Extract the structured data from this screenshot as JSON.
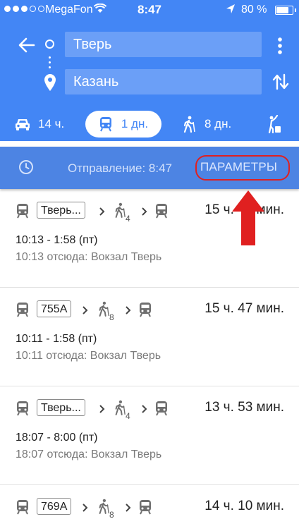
{
  "status_bar": {
    "carrier": "MegaFon",
    "time": "8:47",
    "battery_pct": "80 %",
    "battery_level": 0.8,
    "signal_bars_filled": 3,
    "signal_bars_total": 5
  },
  "search": {
    "origin": "Тверь",
    "destination": "Казань"
  },
  "modes": {
    "car": "14 ч.",
    "transit": "1 дн.",
    "walk": "8 дн."
  },
  "departure": {
    "label": "Отправление: 8:47",
    "params_label": "ПАРАМЕТРЫ"
  },
  "routes": [
    {
      "badge": "Тверь...",
      "walk_minutes": "4",
      "duration": "15 ч. 47 мин.",
      "times": "10:13 - 1:58 (пт)",
      "from": "10:13 отсюда: Вокзал Тверь"
    },
    {
      "badge": "755A",
      "walk_minutes": "8",
      "duration": "15 ч. 47 мин.",
      "times": "10:11 - 1:58 (пт)",
      "from": "10:11 отсюда: Вокзал Тверь"
    },
    {
      "badge": "Тверь...",
      "walk_minutes": "4",
      "duration": "13 ч. 53 мин.",
      "times": "18:07 - 8:00 (пт)",
      "from": "18:07 отсюда: Вокзал Тверь"
    },
    {
      "badge": "769A",
      "walk_minutes": "8",
      "duration": "14 ч. 10 мин.",
      "times": "",
      "from": ""
    }
  ],
  "colors": {
    "header_blue": "#4386f5",
    "depart_bar": "#4d84e3",
    "annotation_red": "#e02020"
  },
  "icons": [
    "back-arrow-icon",
    "origin-circle-icon",
    "destination-pin-icon",
    "more-vert-icon",
    "swap-icon",
    "car-icon",
    "train-icon",
    "walk-icon",
    "ride-icon",
    "clock-icon",
    "wifi-icon",
    "location-arrow-icon",
    "battery-icon",
    "chevron-right-icon"
  ]
}
